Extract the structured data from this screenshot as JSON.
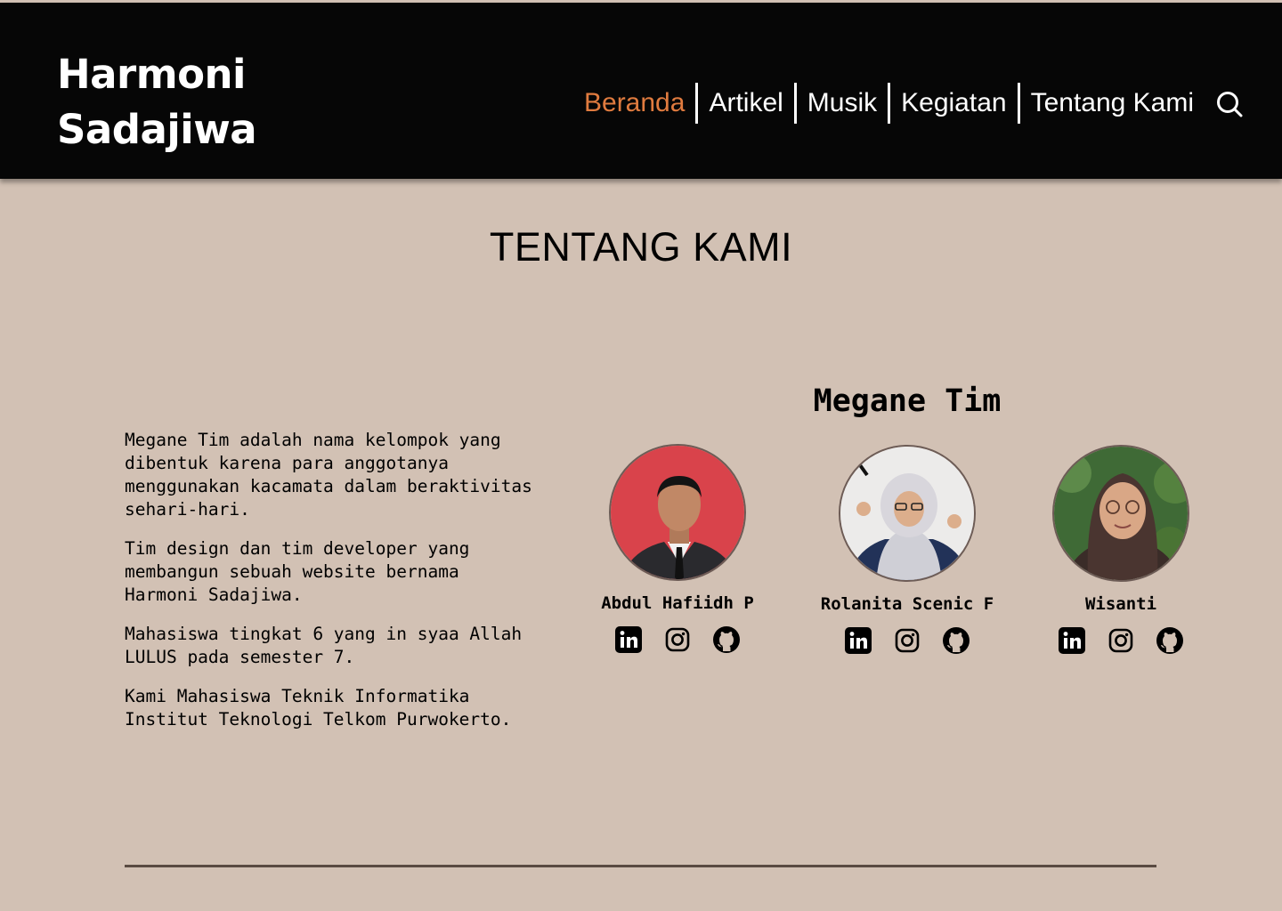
{
  "header": {
    "logo_line1": "Harmoni",
    "logo_line2": "Sadajiwa",
    "nav": [
      {
        "label": "Beranda",
        "active": true
      },
      {
        "label": "Artikel"
      },
      {
        "label": "Musik"
      },
      {
        "label": "Kegiatan"
      },
      {
        "label": "Tentang Kami"
      }
    ],
    "search_icon": "search-icon"
  },
  "page": {
    "title": "TENTANG KAMI"
  },
  "about": {
    "paragraphs": [
      "Megane Tim adalah nama kelompok yang dibentuk karena para anggotanya menggunakan kacamata dalam beraktivitas sehari-hari.",
      "Tim design dan tim developer yang membangun sebuah website bernama Harmoni Sadajiwa.",
      "Mahasiswa tingkat 6 yang in syaa Allah LULUS pada semester 7.",
      "Kami Mahasiswa Teknik Informatika Institut Teknologi Telkom Purwokerto."
    ]
  },
  "team": {
    "title": "Megane Tim",
    "members": [
      {
        "name": "Abdul Hafiidh P"
      },
      {
        "name": "Rolanita Scenic F"
      },
      {
        "name": "Wisanti"
      }
    ],
    "social_icons": [
      "linkedin-icon",
      "instagram-icon",
      "github-icon"
    ]
  },
  "colors": {
    "background": "#d2c1b4",
    "header": "#060606",
    "accent": "#e07b3f"
  }
}
